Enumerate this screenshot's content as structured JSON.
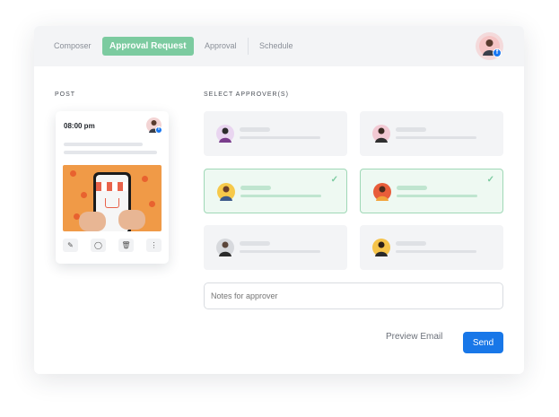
{
  "tabs": [
    {
      "label": "Composer"
    },
    {
      "label": "Approval Request",
      "active": true
    },
    {
      "label": "Approval"
    },
    {
      "label": "Schedule"
    }
  ],
  "colors": {
    "accent_green": "#7ccba0",
    "primary_blue": "#1877e8",
    "facebook_blue": "#1877f2"
  },
  "post": {
    "section_label": "POST",
    "time": "08:00 pm",
    "actions": [
      "edit-icon",
      "comment-icon",
      "trash-icon",
      "more-icon"
    ],
    "social_icon": "facebook-icon"
  },
  "approvers": {
    "section_label": "SELECT APPROVER(S)",
    "items": [
      {
        "selected": false
      },
      {
        "selected": false
      },
      {
        "selected": true
      },
      {
        "selected": true
      },
      {
        "selected": false
      },
      {
        "selected": false
      }
    ]
  },
  "notes": {
    "placeholder": "Notes for approver"
  },
  "actions": {
    "preview_label": "Preview Email",
    "send_label": "Send"
  }
}
